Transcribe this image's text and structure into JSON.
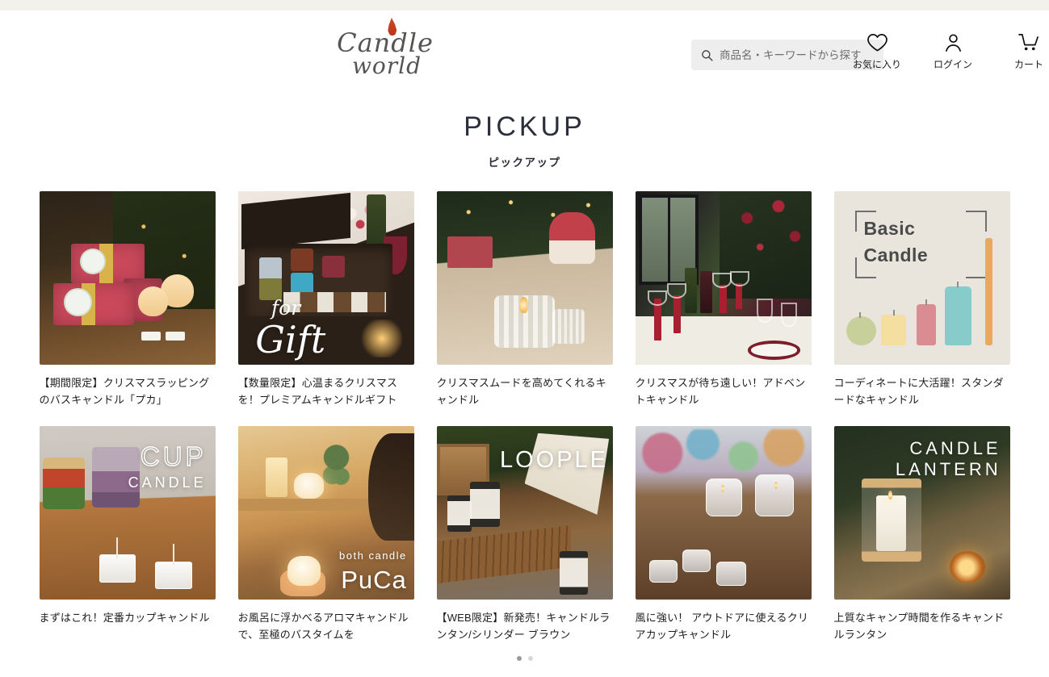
{
  "header": {
    "logo": {
      "line1": "Candle",
      "line2": "world",
      "icon": "candle-flame-icon"
    },
    "search": {
      "placeholder": "商品名・キーワードから探す",
      "value": "",
      "icon": "search-icon"
    },
    "utils": [
      {
        "label": "お気に入り",
        "icon": "heart-icon"
      },
      {
        "label": "ログイン",
        "icon": "user-icon"
      },
      {
        "label": "カート",
        "icon": "cart-icon"
      }
    ]
  },
  "section": {
    "title": "PICKUP",
    "subtitle": "ピックアップ"
  },
  "products": [
    {
      "caption": "【期間限定】クリスマスラッピングのバスキャンドル「プカ」",
      "image_alt": "christmas-wrapped-bath-candle-boxes",
      "overlay": []
    },
    {
      "caption": "【数量限定】心温まるクリスマスを！プレミアムキャンドルギフト",
      "image_alt": "premium-candle-gift-box",
      "overlay": [
        "for",
        "Gift"
      ]
    },
    {
      "caption": "クリスマスムードを高めてくれるキャンドル",
      "image_alt": "ribbed-glass-candle-holder",
      "overlay": []
    },
    {
      "caption": "クリスマスが待ち遠しい！アドベントキャンドル",
      "image_alt": "christmas-table-advent-candles",
      "overlay": []
    },
    {
      "caption": "コーディネートに大活躍！スタンダードなキャンドル",
      "image_alt": "basic-candle-lineup",
      "overlay": [
        "Basic",
        "Candle"
      ]
    },
    {
      "caption": "まずはこれ！定番カップキャンドル",
      "image_alt": "cup-candle-tealights",
      "overlay": [
        "CUP",
        "CANDLE"
      ]
    },
    {
      "caption": "お風呂に浮かべるアロマキャンドルで、至極のバスタイムを",
      "image_alt": "bath-candle-puca",
      "overlay": [
        "both candle",
        "PuCa"
      ]
    },
    {
      "caption": "【WEB限定】新発売！キャンドルランタン/シリンダー ブラウン",
      "image_alt": "loople-camping-lanterns",
      "overlay": [
        "LOOPLE"
      ]
    },
    {
      "caption": "風に強い！ アウトドアに使えるクリアカップキャンドル",
      "image_alt": "outdoor-clear-cup-candles",
      "overlay": []
    },
    {
      "caption": "上質なキャンプ時間を作るキャンドルランタン",
      "image_alt": "candle-lantern-outdoor",
      "overlay": [
        "CANDLE",
        "LANTERN"
      ]
    }
  ],
  "colors": {
    "top_strip": "#f3f1ec",
    "title": "#2b2f3a",
    "search_bg": "#eeeeee",
    "flame": "#c63f20"
  }
}
